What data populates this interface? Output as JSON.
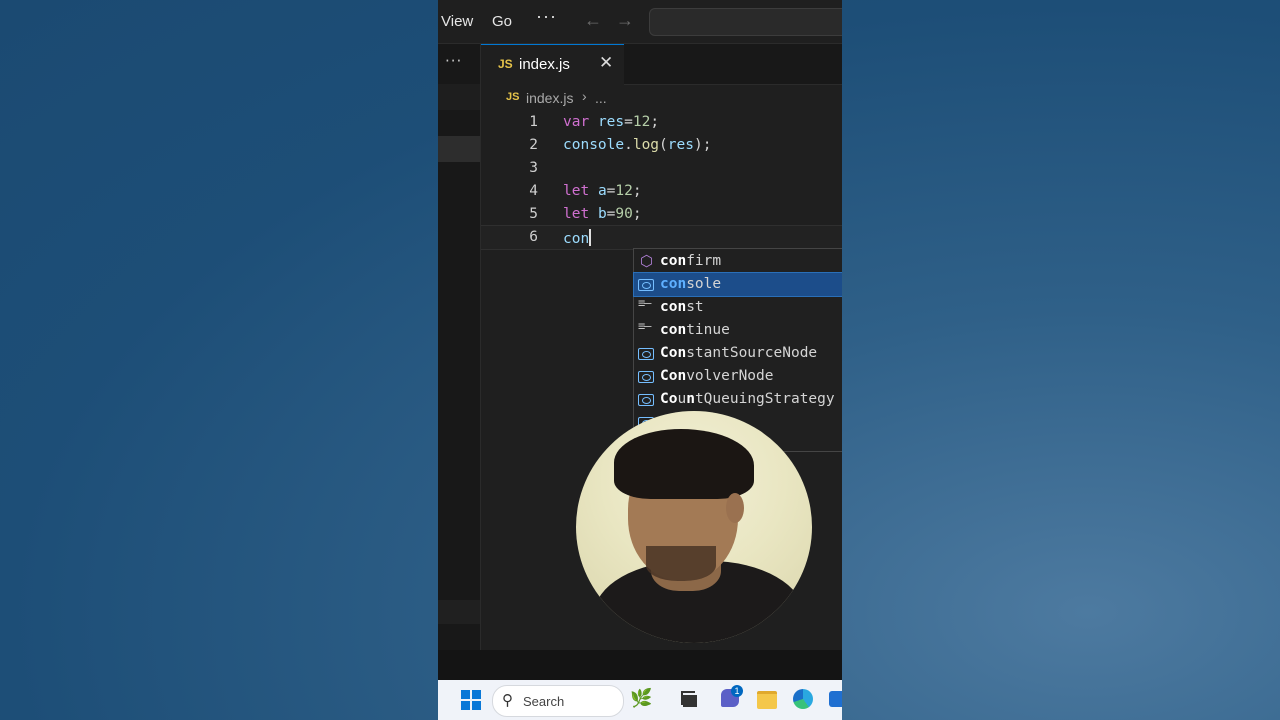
{
  "menu": {
    "view": "View",
    "go": "Go",
    "more": "···"
  },
  "nav": {
    "back": "←",
    "forward": "→"
  },
  "sidebar": {
    "more": "···"
  },
  "tab": {
    "badge": "JS",
    "label": "index.js",
    "close": "✕"
  },
  "breadcrumb": {
    "badge": "JS",
    "file": "index.js",
    "separator": "›",
    "more": "..."
  },
  "code_lines": [
    {
      "num": "1"
    },
    {
      "num": "2"
    },
    {
      "num": "3"
    },
    {
      "num": "4"
    },
    {
      "num": "5"
    },
    {
      "num": "6"
    }
  ],
  "code": {
    "l1": {
      "kw": "var",
      "id": "res",
      "op": "=",
      "num": "12",
      "end": ";"
    },
    "l2": {
      "obj": "console",
      "dot": ".",
      "fn": "log",
      "open": "(",
      "arg": "res",
      "close": ");"
    },
    "l4": {
      "kw": "let",
      "id": "a",
      "op": "=",
      "num": "12",
      "end": ";"
    },
    "l5": {
      "kw": "let",
      "id": "b",
      "op": "=",
      "num": "90",
      "end": ";"
    },
    "l6": {
      "typed": "con"
    }
  },
  "suggestions": [
    {
      "match": "con",
      "rest": "firm",
      "kind": "method"
    },
    {
      "match": "con",
      "rest": "sole",
      "kind": "variable",
      "selected": true
    },
    {
      "match": "con",
      "rest": "st",
      "kind": "keyword"
    },
    {
      "match": "con",
      "rest": "tinue",
      "kind": "keyword"
    },
    {
      "match": "Con",
      "rest": "stantSourceNode",
      "kind": "variable"
    },
    {
      "match": "Con",
      "rest": "volverNode",
      "kind": "variable"
    },
    {
      "match": "Co",
      "rest": "u",
      "rest2": "n",
      "rest3": "tQueuingStrategy",
      "kind": "variable"
    },
    {
      "match": "Co",
      "rest": "",
      "kind": "variable"
    },
    {
      "match": "",
      "rest": "",
      "kind": "variable"
    }
  ],
  "taskbar": {
    "search_label": "Search",
    "chat_badge": "1"
  },
  "colors": {
    "keyword": "#d070d0",
    "identifier": "#9cdcfe",
    "number": "#b5cea8",
    "function": "#dcdcaa",
    "selection": "#1c4d8a",
    "accent": "#0078d4"
  }
}
